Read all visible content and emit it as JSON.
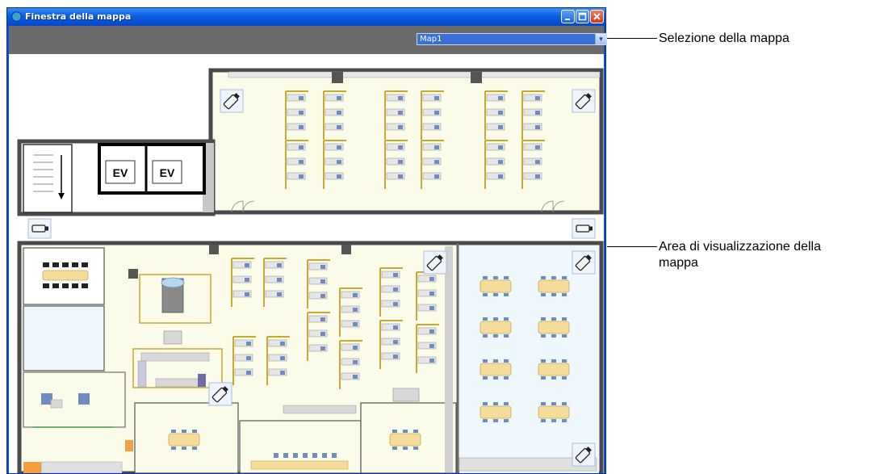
{
  "window": {
    "title": "Finestra della mappa"
  },
  "map_selector": {
    "value": "Map1"
  },
  "annotations": {
    "map_selection": "Selezione della mappa",
    "display_area_line1": "Area di visualizzazione della",
    "display_area_line2": "mappa"
  },
  "floorplan": {
    "elevator_label_1": "EV",
    "elevator_label_2": "EV"
  },
  "colors": {
    "titlebar": "#0a5ee0",
    "toolbar": "#6b6b6b",
    "selector": "#3b6fd8",
    "office_floor": "#fbfbe9",
    "meeting_floor": "#eef8fc",
    "wall": "#4a4a4a",
    "table": "#f6dc9a",
    "chair": "#6f8cc0"
  },
  "icons": [
    "app-globe-icon",
    "minimize-icon",
    "maximize-icon",
    "close-icon",
    "dropdown-arrow-icon",
    "camera-icon"
  ]
}
